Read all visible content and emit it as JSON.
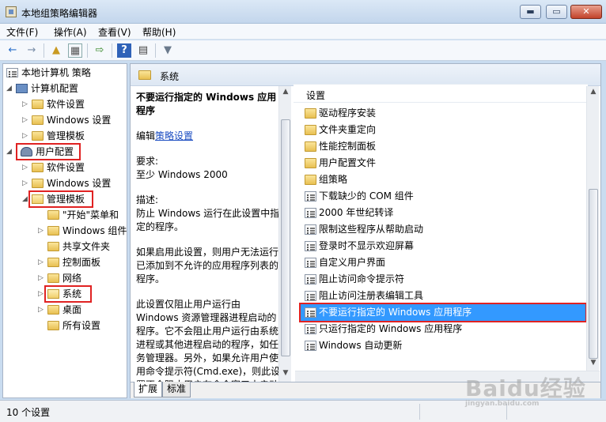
{
  "window": {
    "title": "本地组策略编辑器",
    "min_glyph": "▬",
    "max_glyph": "▭",
    "close_glyph": "✕"
  },
  "menu": [
    "文件(F)",
    "操作(A)",
    "查看(V)",
    "帮助(H)"
  ],
  "toolbar": {
    "back_icon": "←",
    "forward_icon": "→",
    "up_icon": "▲",
    "console_icon": "▦",
    "export_icon": "⇨",
    "help_icon": "?",
    "props_icon": "▤",
    "filter_icon": "▼"
  },
  "tree": {
    "root": "本地计算机 策略",
    "computer_config": "计算机配置",
    "computer_children": [
      "软件设置",
      "Windows 设置",
      "管理模板"
    ],
    "user_config": "用户配置",
    "user_children": [
      "软件设置",
      "Windows 设置",
      "管理模板"
    ],
    "admin_templates_children": [
      "\"开始\"菜单和",
      "Windows 组件",
      "共享文件夹",
      "控制面板",
      "网络",
      "系统",
      "桌面",
      "所有设置"
    ]
  },
  "right_header": "系统",
  "description": {
    "title": "不要运行指定的 Windows 应用程序",
    "edit_prefix": "编辑",
    "edit_link": "策略设置",
    "requirements_label": "要求:",
    "requirements_value": "至少 Windows 2000",
    "desc_label": "描述:",
    "desc_text": "防止 Windows 运行在此设置中指定的程序。",
    "para1": "如果启用此设置，则用户无法运行已添加到不允许的应用程序列表的程序。",
    "para2": "此设置仅阻止用户运行由 Windows 资源管理器进程启动的程序。它不会阻止用户运行由系统进程或其他进程启动的程序，如任务管理器。另外，如果允许用户使用命令提示符(Cmd.exe)，则此设置不会阻止用户在命令窗口中启动"
  },
  "list": {
    "header": "设置",
    "folders": [
      "驱动程序安装",
      "文件夹重定向",
      "性能控制面板",
      "用户配置文件",
      "组策略"
    ],
    "settings": [
      "下载缺少的 COM 组件",
      "2000 年世纪转译",
      "限制这些程序从帮助启动",
      "登录时不显示欢迎屏幕",
      "自定义用户界面",
      "阻止访问命令提示符",
      "阻止访问注册表编辑工具",
      "不要运行指定的 Windows 应用程序",
      "只运行指定的 Windows 应用程序",
      "Windows 自动更新"
    ],
    "selected_index": 7
  },
  "tabs": [
    "扩展",
    "标准"
  ],
  "status": "10 个设置",
  "watermark": {
    "main": "Baidu经验",
    "sub": "jingyan.baidu.com"
  },
  "colors": {
    "selection": "#3399ff",
    "highlight_box": "#e02222",
    "link": "#1a4cc1"
  }
}
